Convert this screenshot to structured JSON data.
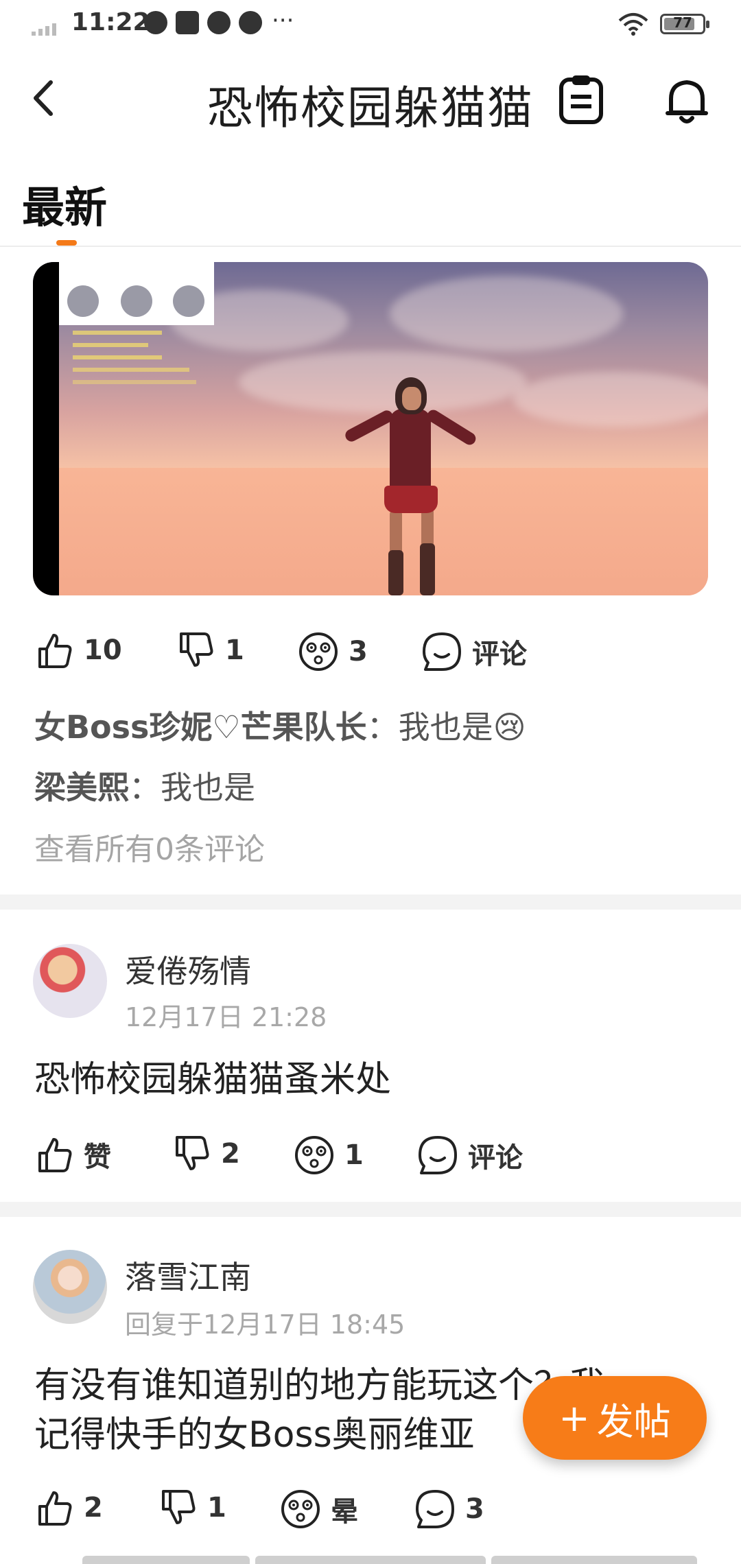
{
  "status_bar": {
    "time": "11:22",
    "more": "···",
    "battery": "77"
  },
  "header": {
    "title": "恐怖校园躲猫猫"
  },
  "tabs": [
    {
      "label": "最新"
    }
  ],
  "post1": {
    "actions": {
      "likes": "10",
      "dislikes": "1",
      "stun": "3",
      "comment": "评论"
    },
    "comments": [
      {
        "user": "女Boss珍妮♡芒果队长",
        "sep": "：",
        "text": "我也是😢"
      },
      {
        "user": "梁美熙",
        "sep": "：",
        "text": "我也是"
      }
    ],
    "view_all": "查看所有0条评论"
  },
  "post2": {
    "user": "爱倦殇情",
    "time": "12月17日 21:28",
    "text": "恐怖校园躲猫猫蚤米处",
    "actions": {
      "likes": "赞",
      "dislikes": "2",
      "stun": "1",
      "comment": "评论"
    }
  },
  "post3": {
    "user": "落雪江南",
    "time": "回复于12月17日 18:45",
    "text_line1": "有没有谁知道别的地方能玩这个？我",
    "text_line2": "记得快手的女Boss奥丽维亚",
    "actions": {
      "likes": "2",
      "dislikes": "1",
      "stun": "晕",
      "comment": "3"
    }
  },
  "fab": {
    "plus": "+",
    "label": "发帖"
  },
  "colors": {
    "accent": "#f77c18"
  }
}
